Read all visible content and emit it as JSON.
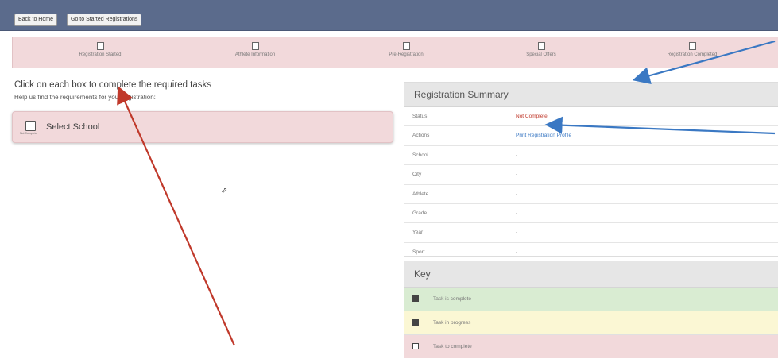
{
  "topbar": {
    "back_home": "Back to Home",
    "go_to_started": "Go to Started Registrations"
  },
  "steps": [
    {
      "label": "Registration Started"
    },
    {
      "label": "Athlete Information"
    },
    {
      "label": "Pre-Registration"
    },
    {
      "label": "Special Offers"
    },
    {
      "label": "Registration Completed"
    }
  ],
  "main": {
    "title": "Click on each box to complete the required tasks",
    "subtitle": "Help us find the requirements for your registration:",
    "task": {
      "label": "Select School",
      "status": "Not Complete"
    }
  },
  "summary": {
    "title": "Registration Summary",
    "rows": [
      {
        "key": "Status",
        "value": "Not Complete"
      },
      {
        "key": "Actions",
        "value": "Print Registration Profile"
      },
      {
        "key": "School",
        "value": "-"
      },
      {
        "key": "City",
        "value": "-"
      },
      {
        "key": "Athlete",
        "value": "-"
      },
      {
        "key": "Grade",
        "value": "-"
      },
      {
        "key": "Year",
        "value": "-"
      },
      {
        "key": "Sport",
        "value": "-"
      }
    ]
  },
  "key": {
    "title": "Key",
    "items": [
      {
        "label": "Task is complete"
      },
      {
        "label": "Task in progress"
      },
      {
        "label": "Task to complete"
      }
    ]
  },
  "colors": {
    "topbar": "#5b6b8c",
    "incomplete": "#f2d9db",
    "complete": "#d9ecd2",
    "progress": "#fbf7d4",
    "link": "#3a78c3",
    "error": "#c0392b",
    "annotation_red": "#c0392b",
    "annotation_blue": "#3a78c3"
  }
}
